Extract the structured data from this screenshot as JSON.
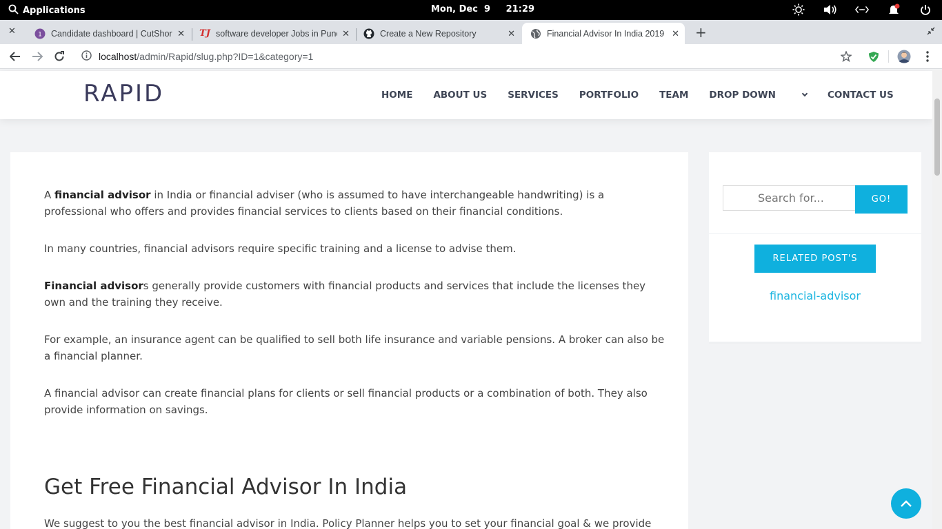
{
  "os": {
    "applications_label": "Applications",
    "date": "Mon, Dec  9",
    "time": "21:29",
    "tray_icons": [
      "brightness-icon",
      "volume-icon",
      "network-icon",
      "notification-icon",
      "power-icon"
    ]
  },
  "tabs": [
    {
      "title": "Candidate dashboard | CutShort",
      "favicon": "cutshort-icon",
      "badge": "1",
      "active": false
    },
    {
      "title": "software developer Jobs in Pune",
      "favicon": "timesjobs-icon",
      "badge": "TJ",
      "active": false
    },
    {
      "title": "Create a New Repository",
      "favicon": "github-icon",
      "active": false
    },
    {
      "title": "Financial Advisor In India 2019",
      "favicon": "globe-icon",
      "active": true
    }
  ],
  "address_bar": {
    "host": "localhost",
    "path": "/admin/Rapid/slug.php?ID=1&category=1"
  },
  "site": {
    "logo": "RAPID",
    "menu": [
      "HOME",
      "ABOUT US",
      "SERVICES",
      "PORTFOLIO",
      "TEAM",
      "DROP DOWN",
      "CONTACT US"
    ]
  },
  "article": {
    "p1_bold": "financial advisor",
    "p1_pre": "A ",
    "p1_post": " in India or financial adviser (who is assumed to have interchangeable handwriting) is a professional who offers and provides financial services to clients based on their financial conditions.",
    "p2": "In many countries, financial advisors require specific training and a license to advise them.",
    "p3_bold": "Financial advisor",
    "p3_post": "s generally provide customers with financial products and services that include the licenses they own and the training they receive.",
    "p4": "For example, an insurance agent can be qualified to sell both life insurance and variable pensions. A broker can also be a financial planner.",
    "p5": "A financial advisor can create financial plans for clients or sell financial products or a combination of both. They also provide information on savings.",
    "heading": "Get Free Financial Advisor In India",
    "p6": "We suggest to you the best financial advisor in India. Policy Planner helps you to set your financial goal & we provide"
  },
  "sidebar": {
    "search_placeholder": "Search for...",
    "search_button": "GO!",
    "related_button": "RELATED POST'S",
    "related_link": "financial-advisor"
  },
  "colors": {
    "accent": "#0fb0de",
    "link": "#19b4e0",
    "logo": "#3b3b5c"
  }
}
